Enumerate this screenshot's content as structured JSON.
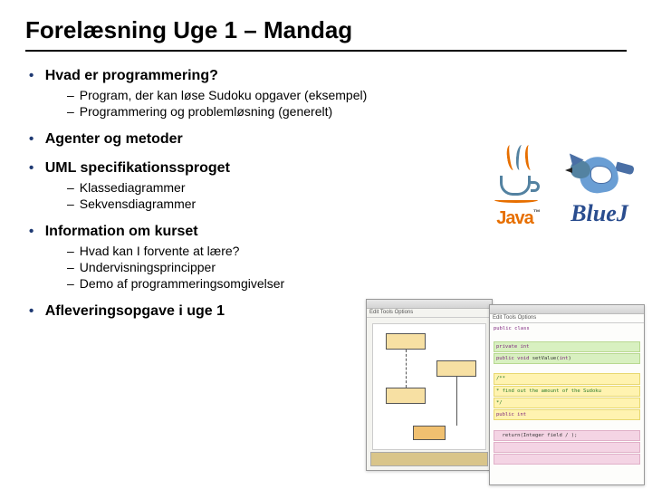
{
  "title": "Forelæsning Uge 1 – Mandag",
  "bullets": [
    {
      "text": "Hvad er programmering?",
      "subs": [
        "Program, der kan løse Sudoku opgaver (eksempel)",
        "Programmering og problemløsning (generelt)"
      ]
    },
    {
      "text": "Agenter og metoder",
      "subs": []
    },
    {
      "text": "UML specifikationssproget",
      "subs": [
        "Klassediagrammer",
        "Sekvensdiagrammer"
      ]
    },
    {
      "text": "Information om kurset",
      "subs": [
        "Hvad kan I forvente at lære?",
        "Undervisningsprincipper",
        "Demo af programmeringsomgivelser"
      ]
    },
    {
      "text": "Afleveringsopgave i uge 1",
      "subs": []
    }
  ],
  "logos": {
    "java": "Java",
    "bluej": "BlueJ"
  },
  "ide": {
    "menus": "Edit  Tools  Options"
  }
}
